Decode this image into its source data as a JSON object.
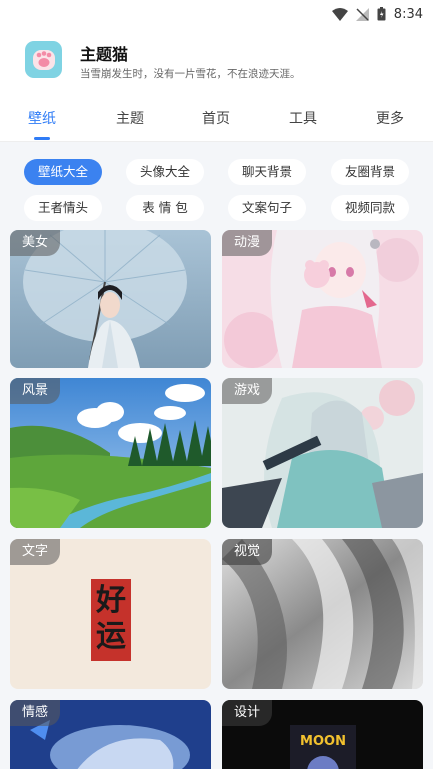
{
  "status": {
    "time": "8:34"
  },
  "app": {
    "title": "主题猫",
    "subtitle": "当雪崩发生时，没有一片雪花，不在浪迹天涯。",
    "icon": "cat-paw-icon"
  },
  "tabs": [
    {
      "label": "壁纸",
      "active": true
    },
    {
      "label": "主题",
      "active": false
    },
    {
      "label": "首页",
      "active": false
    },
    {
      "label": "工具",
      "active": false
    },
    {
      "label": "更多",
      "active": false
    }
  ],
  "categories": [
    {
      "label": "壁纸大全",
      "active": true
    },
    {
      "label": "头像大全",
      "active": false
    },
    {
      "label": "聊天背景",
      "active": false
    },
    {
      "label": "友圈背景",
      "active": false
    },
    {
      "label": "王者情头",
      "active": false
    },
    {
      "label": "表 情 包",
      "active": false
    },
    {
      "label": "文案句子",
      "active": false
    },
    {
      "label": "视频同款",
      "active": false
    }
  ],
  "cards": [
    {
      "label": "美女"
    },
    {
      "label": "动漫"
    },
    {
      "label": "风景"
    },
    {
      "label": "游戏"
    },
    {
      "label": "文字",
      "calligraphy_top": "好",
      "calligraphy_bottom": "运"
    },
    {
      "label": "视觉"
    },
    {
      "label": "情感"
    },
    {
      "label": "设计",
      "poster_text": "MOON"
    }
  ],
  "colors": {
    "accent": "#3b82f0",
    "tab_active": "#2f7cf6"
  }
}
